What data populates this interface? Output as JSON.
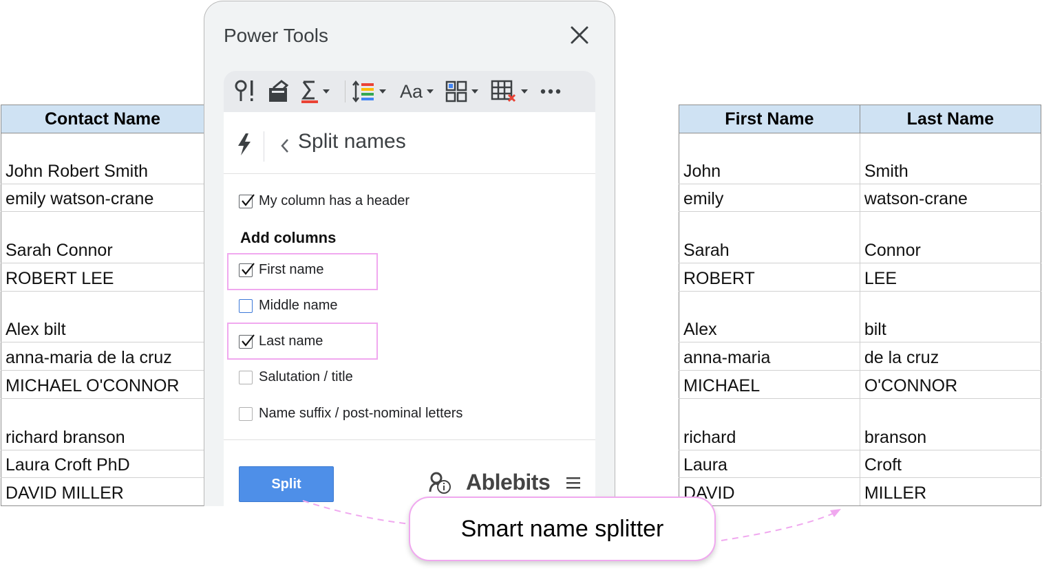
{
  "left_table": {
    "header": "Contact Name",
    "rows": [
      "John Robert Smith",
      "emily watson-crane",
      "Sarah Connor",
      "ROBERT LEE",
      "Alex bilt",
      "anna-maria de la cruz",
      "MICHAEL O'CONNOR",
      "richard branson",
      "Laura Croft PhD",
      "DAVID MILLER"
    ]
  },
  "right_table": {
    "headers": [
      "First Name",
      "Last Name"
    ],
    "rows": [
      [
        "John",
        "Smith"
      ],
      [
        "emily",
        "watson-crane"
      ],
      [
        "Sarah",
        "Connor"
      ],
      [
        "ROBERT",
        "LEE"
      ],
      [
        "Alex",
        "bilt"
      ],
      [
        "anna-maria",
        "de la cruz"
      ],
      [
        "MICHAEL",
        "O'CONNOR"
      ],
      [
        "richard",
        "branson"
      ],
      [
        "Laura",
        "Croft"
      ],
      [
        "DAVID",
        "MILLER"
      ]
    ]
  },
  "panel": {
    "title": "Power Tools",
    "toolbar": {
      "items": [
        "search-replace-icon",
        "clear-icon",
        "sum-icon",
        "line-spacing-icon",
        "text-case-icon",
        "split-merge-icon",
        "remove-table-icon",
        "more-icon"
      ],
      "case_label": "Aa"
    },
    "section_title": "Split names",
    "header_option": {
      "label": "My column has a header",
      "checked": true
    },
    "add_columns_label": "Add columns",
    "options": [
      {
        "label": "First name",
        "checked": true
      },
      {
        "label": "Middle name",
        "checked": false
      },
      {
        "label": "Last name",
        "checked": true
      },
      {
        "label": "Salutation / title",
        "checked": false
      },
      {
        "label": "Name suffix / post-nominal letters",
        "checked": false
      }
    ],
    "split_button": "Split",
    "brand": "Ablebits"
  },
  "callout": {
    "text": "Smart name splitter"
  },
  "colors": {
    "header_bg": "#cfe2f3",
    "accent_blue": "#4e8fe8",
    "highlight_pink": "#f0a8ef"
  }
}
